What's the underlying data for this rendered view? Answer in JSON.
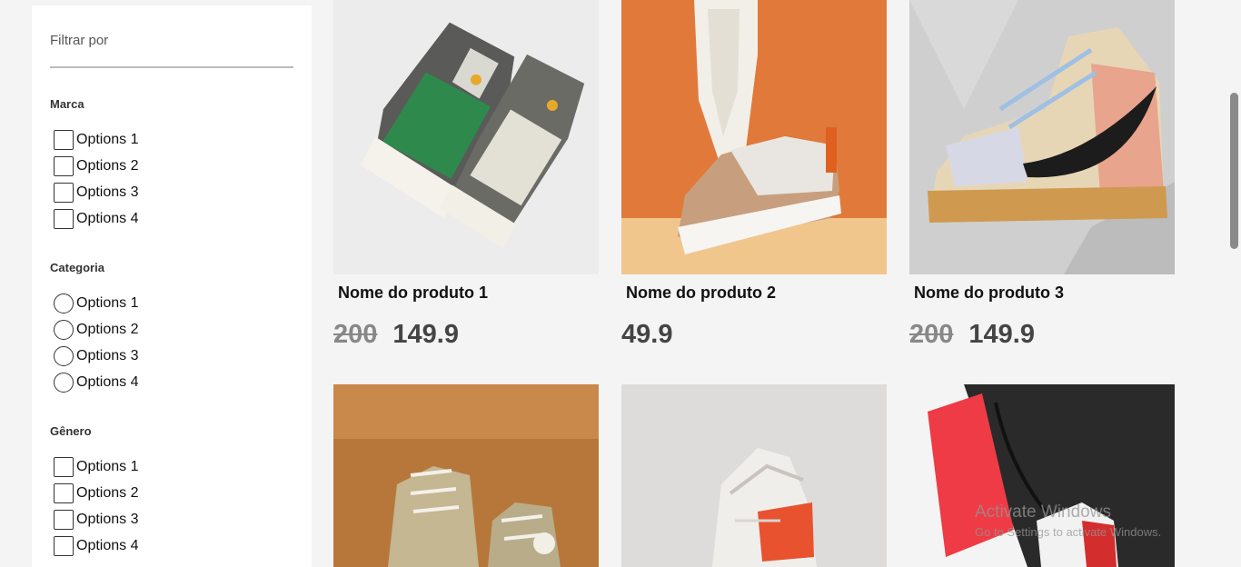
{
  "sidebar": {
    "title": "Filtrar por",
    "groups": [
      {
        "title": "Marca",
        "type": "checkbox",
        "options": [
          "Options 1",
          "Options 2",
          "Options 3",
          "Options 4"
        ]
      },
      {
        "title": "Categoria",
        "type": "radio",
        "options": [
          "Options 1",
          "Options 2",
          "Options 3",
          "Options 4"
        ]
      },
      {
        "title": "Gênero",
        "type": "checkbox",
        "options": [
          "Options 1",
          "Options 2",
          "Options 3",
          "Options 4"
        ]
      }
    ]
  },
  "products": [
    {
      "name": "Nome do produto 1",
      "old_price": "200",
      "price": "149.9",
      "image": "green-grey-high-top-sneakers"
    },
    {
      "name": "Nome do produto 2",
      "old_price": "",
      "price": "49.9",
      "image": "white-beige-sneakers-orange-background"
    },
    {
      "name": "Nome do produto 3",
      "old_price": "200",
      "price": "149.9",
      "image": "peach-high-top-sneaker"
    },
    {
      "name": "",
      "old_price": "",
      "price": "",
      "image": "beige-canvas-high-tops"
    },
    {
      "name": "",
      "old_price": "",
      "price": "",
      "image": "white-orange-running-shoe"
    },
    {
      "name": "",
      "old_price": "",
      "price": "",
      "image": "red-white-sneaker-dark-background"
    }
  ],
  "watermark": {
    "line1": "Activate Windows",
    "line2": "Go to Settings to activate Windows."
  },
  "colors": {
    "background": "#f4f4f4",
    "panel": "#ffffff",
    "old_price": "#888888",
    "price": "#444444"
  }
}
